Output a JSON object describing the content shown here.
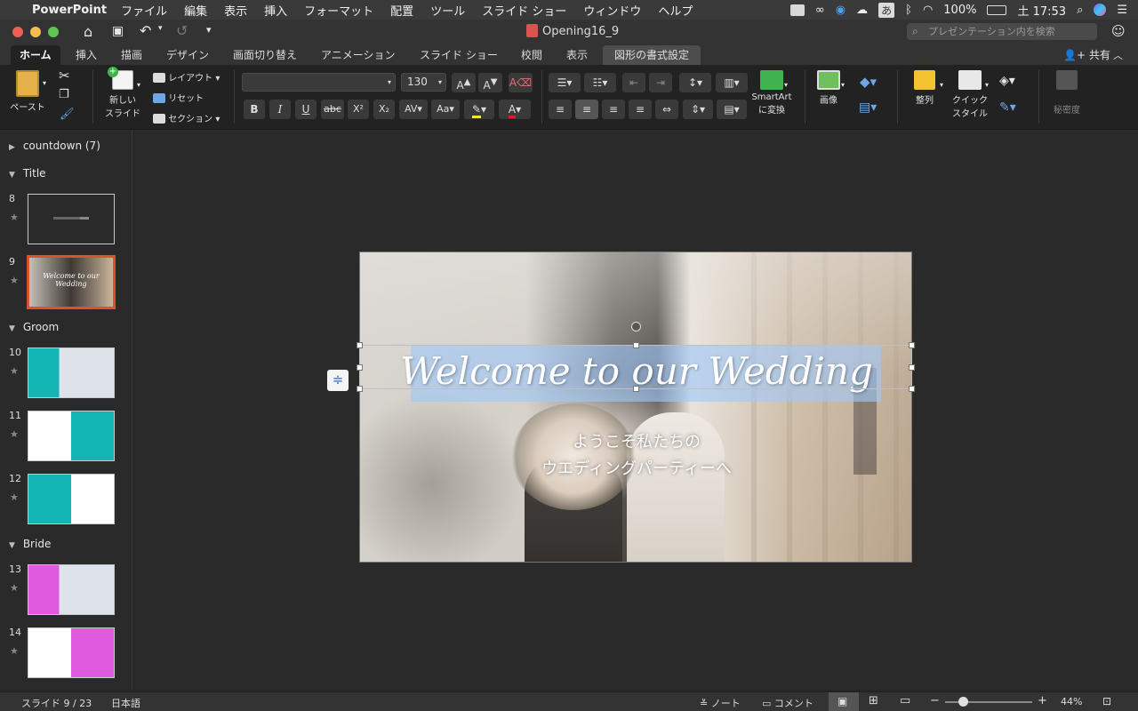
{
  "menubar": {
    "app_name": "PowerPoint",
    "items": [
      "ファイル",
      "編集",
      "表示",
      "挿入",
      "フォーマット",
      "配置",
      "ツール",
      "スライド ショー",
      "ウィンドウ",
      "ヘルプ"
    ],
    "ime": "あ",
    "battery": "100%",
    "clock": "土 17:53"
  },
  "titlebar": {
    "doc_title": "Opening16_9",
    "search_placeholder": "プレゼンテーション内を検索"
  },
  "tabs": [
    "ホーム",
    "挿入",
    "描画",
    "デザイン",
    "画面切り替え",
    "アニメーション",
    "スライド ショー",
    "校閲",
    "表示",
    "図形の書式設定"
  ],
  "share_label": "共有",
  "ribbon": {
    "paste": "ペースト",
    "new_slide_1": "新しい",
    "new_slide_2": "スライド",
    "layout": "レイアウト",
    "reset": "リセット",
    "section": "セクション",
    "font_size": "130",
    "smartart_1": "SmartArt",
    "smartart_2": "に変換",
    "picture": "画像",
    "arrange": "整列",
    "quick_style_1": "クイック",
    "quick_style_2": "スタイル",
    "sensitivity": "秘密度"
  },
  "slides_panel": {
    "sections": [
      "countdown (7)",
      "Title",
      "Groom",
      "Bride"
    ],
    "slide_numbers": [
      "8",
      "9",
      "10",
      "11",
      "12",
      "13",
      "14"
    ]
  },
  "slide": {
    "title": "Welcome to our Wedding",
    "subtitle_line1": "ようこそ私たちの",
    "subtitle_line2": "ウエディングパーティーへ",
    "thumb_title": "Welcome to our Wedding"
  },
  "status": {
    "slide_counter": "スライド 9 / 23",
    "language": "日本語",
    "notes": "ノート",
    "comments": "コメント",
    "zoom": "44%"
  },
  "colors": {
    "teal": "#12b5b3",
    "magenta": "#e05ae0",
    "selection_blue": "#a6c8fa",
    "selected_thumb_border": "#d9532f"
  }
}
